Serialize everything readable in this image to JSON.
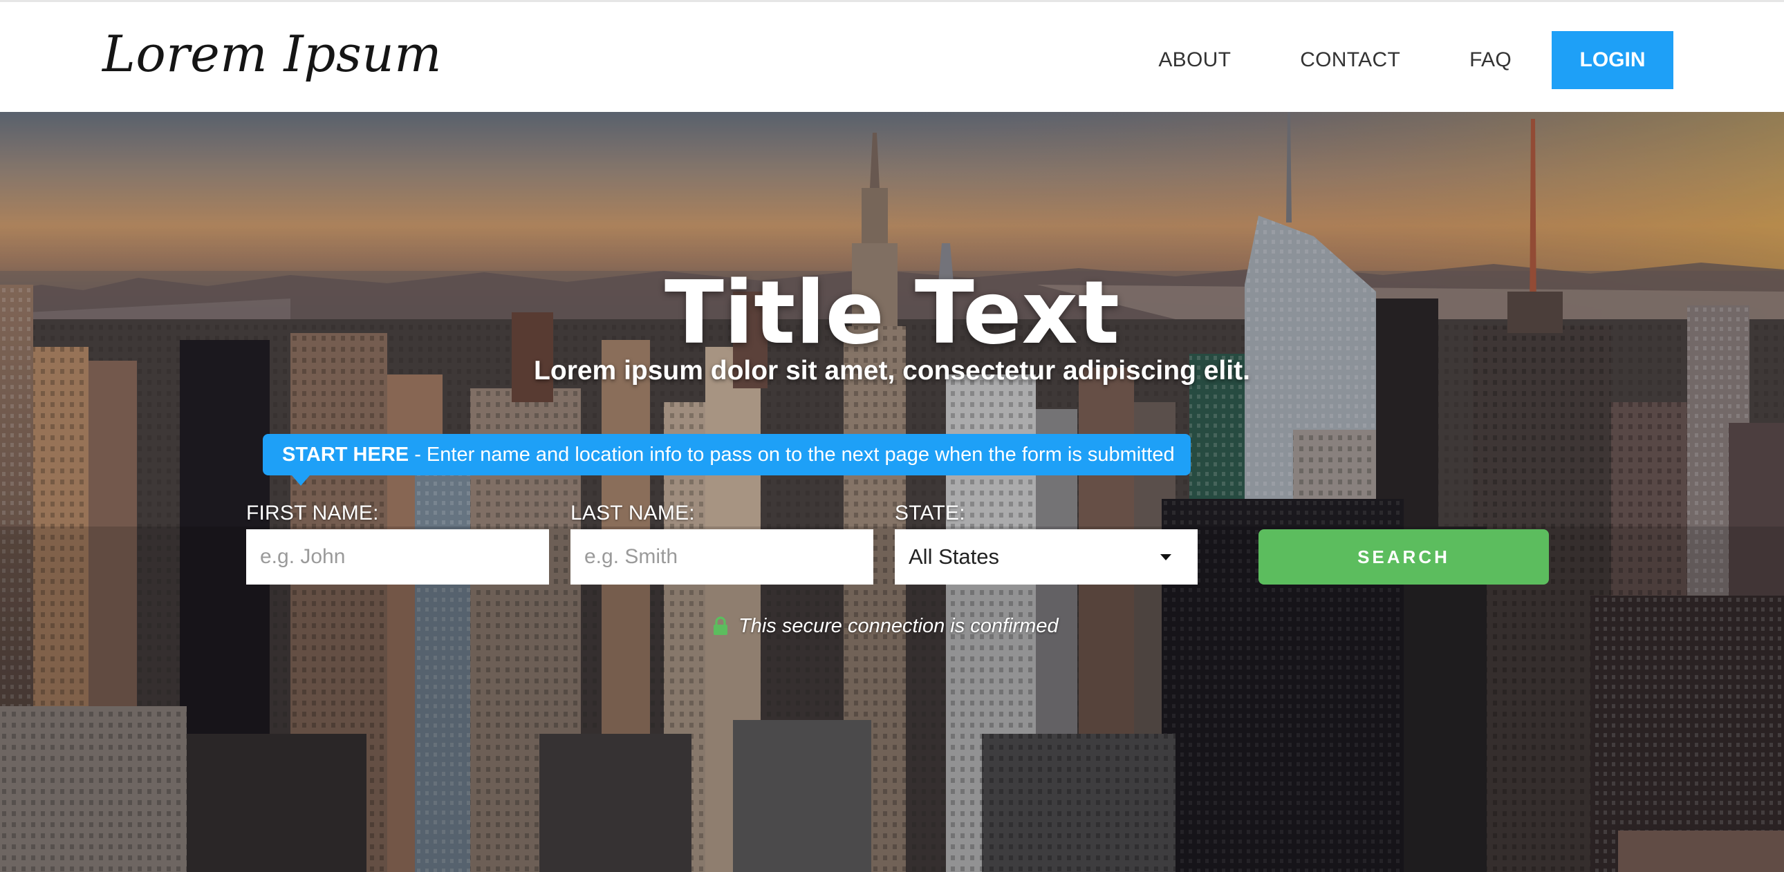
{
  "header": {
    "logo": "Lorem Ipsum",
    "nav": [
      {
        "label": "ABOUT"
      },
      {
        "label": "CONTACT"
      },
      {
        "label": "FAQ"
      }
    ],
    "login_label": "LOGIN"
  },
  "hero": {
    "title": "Title Text",
    "subtitle": "Lorem ipsum dolor sit amet, consectetur adipiscing elit.",
    "banner": {
      "strong": "START HERE",
      "text": " - Enter name and location info to pass on to the next page when the form is submitted"
    }
  },
  "form": {
    "first_name": {
      "label": "FIRST NAME:",
      "placeholder": "e.g. John",
      "value": ""
    },
    "last_name": {
      "label": "LAST NAME:",
      "placeholder": "e.g. Smith",
      "value": ""
    },
    "state": {
      "label": "STATE:",
      "selected": "All States"
    },
    "search_label": "SEARCH",
    "secure_note": "This secure connection is confirmed"
  },
  "colors": {
    "accent_blue": "#1ea0f7",
    "search_green": "#5cbd5e",
    "lock_green": "#5cbd5e"
  },
  "icons": {
    "lock": "lock-icon",
    "dropdown": "caret-down-icon"
  }
}
